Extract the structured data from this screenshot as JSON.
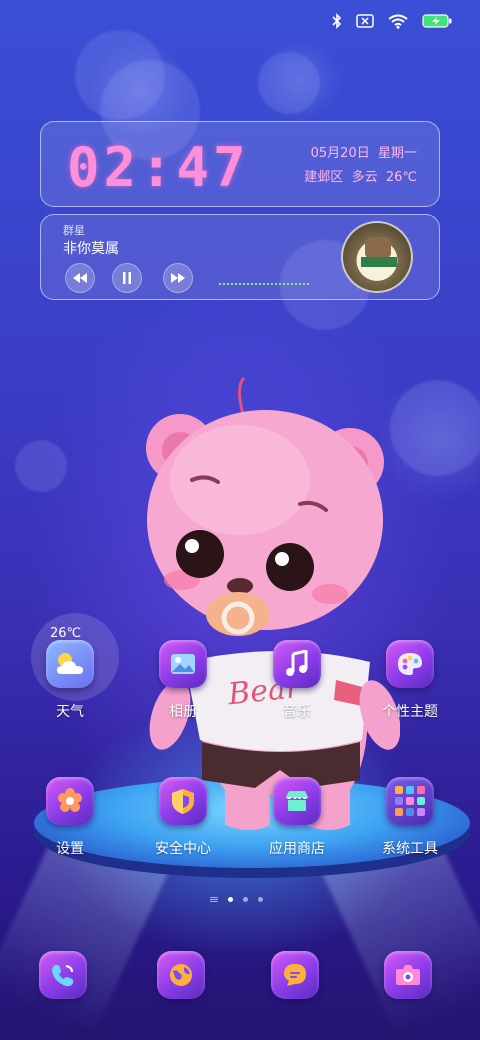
{
  "status_bar": {
    "icons": [
      "bluetooth-icon",
      "no-sim-icon",
      "wifi-icon",
      "battery-charging-icon"
    ],
    "accent": "#3ee37a"
  },
  "clock_widget": {
    "time": "02:47",
    "date": "05月20日",
    "weekday": "星期一",
    "location": "建邺区",
    "weather": "多云",
    "temperature": "26℃",
    "time_color": "#ff8fd8"
  },
  "music_widget": {
    "artist": "群星",
    "song": "非你莫属",
    "controls": [
      "previous-icon",
      "pause-icon",
      "next-icon"
    ]
  },
  "apps_row1": [
    {
      "label": "天气",
      "icon": "weather-icon",
      "badge": "26℃"
    },
    {
      "label": "相册",
      "icon": "gallery-icon"
    },
    {
      "label": "音乐",
      "icon": "music-note-icon"
    },
    {
      "label": "个性主题",
      "icon": "palette-icon"
    }
  ],
  "apps_row2": [
    {
      "label": "设置",
      "icon": "gear-icon"
    },
    {
      "label": "安全中心",
      "icon": "shield-icon"
    },
    {
      "label": "应用商店",
      "icon": "store-icon"
    },
    {
      "label": "系统工具",
      "icon": "folder-icon"
    }
  ],
  "dock": [
    {
      "icon": "phone-icon"
    },
    {
      "icon": "browser-icon"
    },
    {
      "icon": "message-icon"
    },
    {
      "icon": "camera-icon"
    }
  ],
  "page_indicator": {
    "pages": 3,
    "current": 1
  },
  "wallpaper": {
    "bear_shirt_text": "Bear"
  }
}
